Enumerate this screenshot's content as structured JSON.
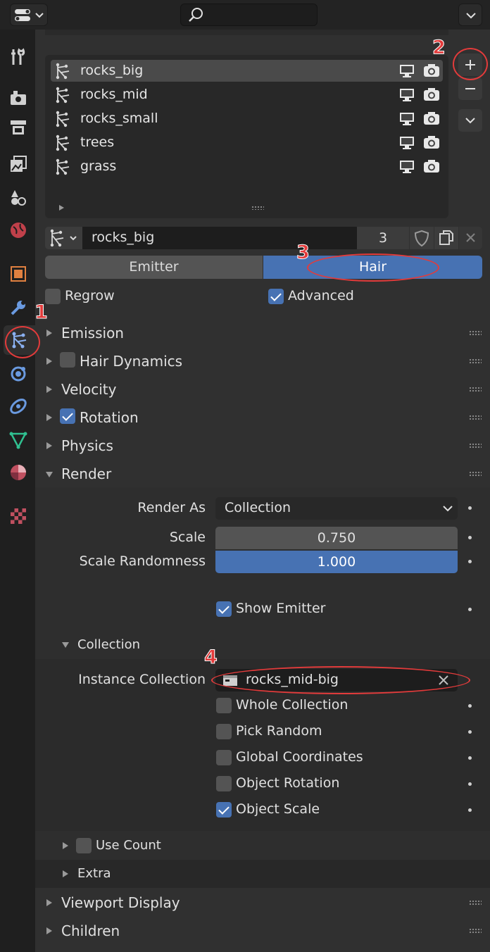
{
  "particle_systems": [
    {
      "name": "rocks_big",
      "selected": true
    },
    {
      "name": "rocks_mid",
      "selected": false
    },
    {
      "name": "rocks_small",
      "selected": false
    },
    {
      "name": "trees",
      "selected": false
    },
    {
      "name": "grass",
      "selected": false
    }
  ],
  "datablock": {
    "name": "rocks_big",
    "users": "3"
  },
  "type_toggle": {
    "emitter": "Emitter",
    "hair": "Hair",
    "active": "Hair"
  },
  "options": {
    "regrow": {
      "label": "Regrow",
      "checked": false
    },
    "advanced": {
      "label": "Advanced",
      "checked": true
    }
  },
  "panels": {
    "emission": "Emission",
    "hair_dynamics": "Hair Dynamics",
    "velocity": "Velocity",
    "rotation": "Rotation",
    "physics": "Physics",
    "render": "Render",
    "viewport_display": "Viewport Display",
    "children": "Children"
  },
  "render": {
    "render_as_label": "Render As",
    "render_as_value": "Collection",
    "scale_label": "Scale",
    "scale_value": "0.750",
    "scale_randomness_label": "Scale Randomness",
    "scale_randomness_value": "1.000",
    "scale_randomness_fill": 1.0,
    "show_emitter": "Show Emitter",
    "collection": {
      "header": "Collection",
      "instance_label": "Instance Collection",
      "instance_value": "rocks_mid-big",
      "whole_collection": "Whole Collection",
      "pick_random": "Pick Random",
      "global_coordinates": "Global Coordinates",
      "object_rotation": "Object Rotation",
      "object_scale": "Object Scale"
    },
    "use_count": "Use Count",
    "extra": "Extra"
  },
  "annotations": [
    "1",
    "2",
    "3",
    "4"
  ],
  "colors": {
    "accent": "#4772b3",
    "annotation": "#e23b3b"
  }
}
